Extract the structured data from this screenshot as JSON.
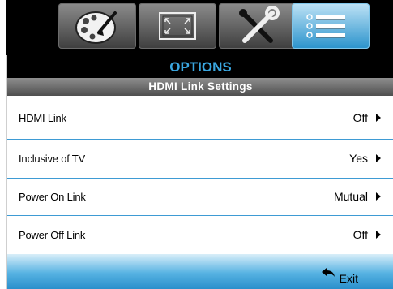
{
  "tabs": [
    {
      "name": "image-settings",
      "icon": "palette-icon"
    },
    {
      "name": "display",
      "icon": "display-frame-icon"
    },
    {
      "name": "setup",
      "icon": "tools-icon"
    },
    {
      "name": "options",
      "icon": "options-list-icon",
      "active": true
    }
  ],
  "menu": {
    "title": "OPTIONS",
    "subtitle": "HDMI Link Settings",
    "items": [
      {
        "label": "HDMI Link",
        "value": "Off"
      },
      {
        "label": "Inclusive of TV",
        "value": "Yes"
      },
      {
        "label": "Power On Link",
        "value": "Mutual"
      },
      {
        "label": "Power Off Link",
        "value": "Off"
      }
    ],
    "exit_label": "Exit"
  },
  "colors": {
    "accent": "#2a93cc",
    "title_text": "#3aa6df",
    "separator": "#3e9bd4"
  }
}
